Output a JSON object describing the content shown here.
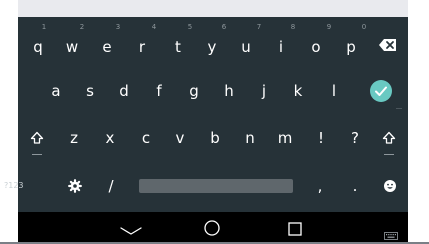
{
  "keyboard": {
    "number_hints": [
      "1",
      "2",
      "3",
      "4",
      "5",
      "6",
      "7",
      "8",
      "9",
      "0"
    ],
    "row1": [
      "q",
      "w",
      "e",
      "r",
      "t",
      "y",
      "u",
      "i",
      "o",
      "p"
    ],
    "row2": [
      "a",
      "s",
      "d",
      "f",
      "g",
      "h",
      "j",
      "k",
      "l"
    ],
    "row3": [
      "z",
      "x",
      "c",
      "v",
      "b",
      "n",
      "m",
      "!",
      "?"
    ],
    "row4": {
      "symbols_label": "?123",
      "slash": "/",
      "comma": ",",
      "period": "."
    }
  },
  "icons": {
    "backspace": "backspace-icon",
    "enter": "check-icon",
    "shift": "shift-icon",
    "settings": "gear-icon",
    "emoji": "emoji-icon",
    "nav_back": "chevron-down-icon",
    "nav_home": "home-icon",
    "nav_recents": "recents-icon",
    "nav_keyboard": "keyboard-icon"
  },
  "colors": {
    "keyboard_bg": "#263238",
    "accent": "#69c9c2",
    "app_area": "#e9eaee"
  }
}
